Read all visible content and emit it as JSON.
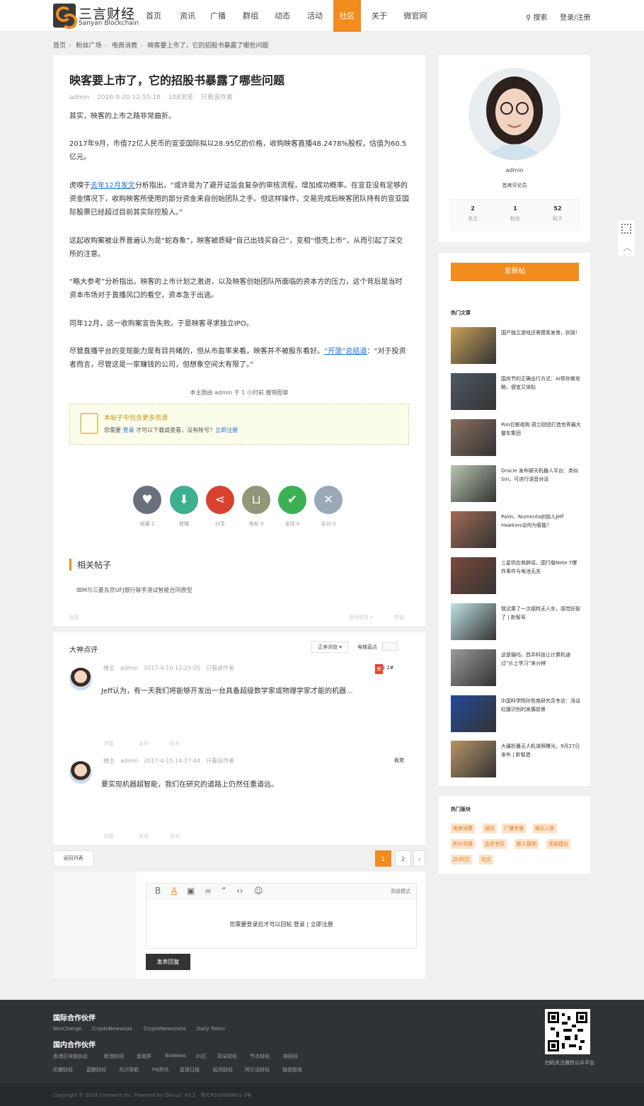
{
  "brand": {
    "name_cn": "三言财经",
    "name_en": "Sanyan Blockchain"
  },
  "nav": {
    "items": [
      "首页",
      "资讯",
      "广播",
      "群组",
      "动态",
      "活动",
      "社区",
      "关于",
      "微官网"
    ],
    "active": "社区",
    "search": "搜索",
    "login": "登录/注册"
  },
  "breadcrumb": [
    "首页",
    "粉丝广场",
    "电商消费",
    "映客要上市了，它的招股书暴露了哪些问题"
  ],
  "article": {
    "title": "映客要上市了，它的招股书暴露了哪些问题",
    "author": "admin",
    "date": "2016-9-20 12:55:18",
    "views": "108浏览",
    "only_author": "只看该作者",
    "p1": "其实，映客的上市之路非常曲折。",
    "p2": "2017年9月，市值72亿人民币的宣亚国际拟以28.95亿的价格，收购映客直播48.2478%股权，估值为60.5亿元。",
    "p3_pre": "虎嗅于",
    "p3_link": "去年12月发文",
    "p3_post": "分析指出，“或许是为了避开证监会复杂的审核流程，增加成功概率。在宣亚没有足够的资金情况下，收购映客所使用的部分资金来自创始团队之手。但这样操作，交易完成后映客团队持有的宣亚国际股票已经超过目前其实际控股人。”",
    "p4": "这起收购案被业界普遍认为是“蛇吞象”，映客被质疑“自己出钱买自己”，变相“借壳上市”，从而引起了深交所的注意。",
    "p5": "“略大参考”分析指出，映客的上市计划之激进，以及映客创始团队所面临的资本方的压力，这个背后是当时资本市场对于直播风口的看空，资本急于出逃。",
    "p6": "同年12月，这一收购案宣告失败。于是映客寻求独立IPO。",
    "p7_pre": "尽管直播平台的变现能力是有目共睹的，但从市盈率来看，映客并不被股东看好。",
    "p7_link": "“开菠”总结道",
    "p7_post": "：“对于投资者而言，尽管这是一家赚钱的公司，但想象空间太有限了。”",
    "edit_note": "本主题由 admin 于 1 小时前 撤销图章",
    "attach_title": "本帖子中包含更多资源",
    "attach_pre": "您需要",
    "attach_login": "登录",
    "attach_mid": "才可以下载或查看，没有帐号？",
    "attach_reg": "立即注册"
  },
  "actions": [
    {
      "label": "收藏 2",
      "icon": "heart-plus-icon",
      "color": "#6a717d",
      "glyph": "♥"
    },
    {
      "label": "转播",
      "icon": "download-icon",
      "color": "#3cb08f",
      "glyph": "⬇"
    },
    {
      "label": "分享",
      "icon": "share-icon",
      "color": "#d9412f",
      "glyph": "⋖"
    },
    {
      "label": "淘帖 0",
      "icon": "cart-icon",
      "color": "#949579",
      "glyph": "🛒"
    },
    {
      "label": "支持 0",
      "icon": "check-icon",
      "color": "#3cb054",
      "glyph": "✔"
    },
    {
      "label": "反对 0",
      "icon": "x-icon",
      "color": "#9aa8b8",
      "glyph": "✕"
    }
  ],
  "related": {
    "title": "相关帖子",
    "item": "IBM与三菱东京UFJ银行联手测试智能合同原型"
  },
  "post_foot": {
    "reply": "回复",
    "use_tool": "使用道具 ▾",
    "report": "举报"
  },
  "comments": {
    "title": "大神点评",
    "sort": "正序浏览 ▾",
    "direct": "电梯直达",
    "list": [
      {
        "role": "楼主",
        "author": "admin",
        "date": "2017-4-10 12:25:05",
        "only": "只看该作者",
        "floor_tag": "来",
        "floor": "来自 2#",
        "body": "Jeff认为，有一天我们将能够开发出一台具备超级数学家或物理学家才能的机器..."
      },
      {
        "role": "楼主",
        "author": "admin",
        "date": "2017-4-10 14:17:44",
        "only": "只看该作者",
        "floor": "板凳",
        "body": "要实现机器超智能，我们在研究的道路上仍然任重道远。"
      }
    ],
    "foot_reply": "回复",
    "foot_support": "支持",
    "foot_oppose": "反对"
  },
  "pager": {
    "back": "返回列表",
    "pages": [
      "1",
      "2"
    ],
    "next": "›"
  },
  "editor": {
    "advanced": "高级模式",
    "msg_pre": "您需要登录后才可以回帖",
    "login": "登录",
    "sep": " | ",
    "reg": "立即注册",
    "submit": "发表回复"
  },
  "profile": {
    "name": "admin",
    "role": "首席评论员",
    "stats": [
      {
        "n": "2",
        "l": "关注"
      },
      {
        "n": "1",
        "l": "粉丝"
      },
      {
        "n": "52",
        "l": "帖子"
      }
    ]
  },
  "new_post": "发新帖",
  "hot": {
    "title": "热门文章",
    "items": [
      "国产独立游戏还需摸索发育，别哭！",
      "国庆节的正确出行方式：AI帮你做攻略，便宜又体贴",
      "Pon巨额收购 荷兰财团打造世界最大整车集团",
      "Oracle 发布聊天机器人平台：类似Siri，可进行语音对话",
      "Palm、Numenta创始人Jeff Hawkins谈何为智能？",
      "三星供应商辟谣，国行版Note 7爆炸事件与电池无关",
      "我试乘了一次福特无人车，感觉好极了 | 新智驾",
      "这是猫吗，西井科技让计算机通过“片上学习”来分辨",
      "中国科学院孙哲南研究员专访：浅谈虹膜识别的发展前景",
      "大疆折叠无人机谍照曝光，9月27日发布 | 新智造"
    ],
    "colors": [
      "#c9a25a",
      "#4d5966",
      "#8a7060",
      "#b7c8b0",
      "#a06a55",
      "#7a4a3a",
      "#bfe3e6",
      "#9a9a9a",
      "#234a9a",
      "#b89468"
    ]
  },
  "boards": {
    "title": "热门版块",
    "tags": [
      "电商消费",
      "通讯",
      "广播专版",
      "娱乐八卦",
      "积分兑换",
      "会员专区",
      "新人报到",
      "求助建议",
      "ZU时区",
      "社文"
    ]
  },
  "footer": {
    "intl_title": "国际合作伙伴",
    "intl": [
      "NexChange",
      "CryptoNewsAsia",
      "CryptoNewsIndia",
      "Daily Token"
    ],
    "dom_title": "国内合作伙伴",
    "dom1": [
      "香港区块链协会",
      "新浪财经",
      "金融界",
      "BiaNews",
      "31区",
      "耳朵财经",
      "节点财经",
      "核财经"
    ],
    "dom2": [
      "陀螺财经",
      "蓝鲸财经",
      "共识导航",
      "FN资讯",
      "星球日报",
      "起风财经",
      "阿尔法财经",
      "链视智库"
    ],
    "qr_caption": "扫码关注微信公众平台",
    "copyright": "Copyright © 2018 Comsenz Inc. Powered by Discuz! X3.2 · 粤ICP201600801-3号"
  }
}
